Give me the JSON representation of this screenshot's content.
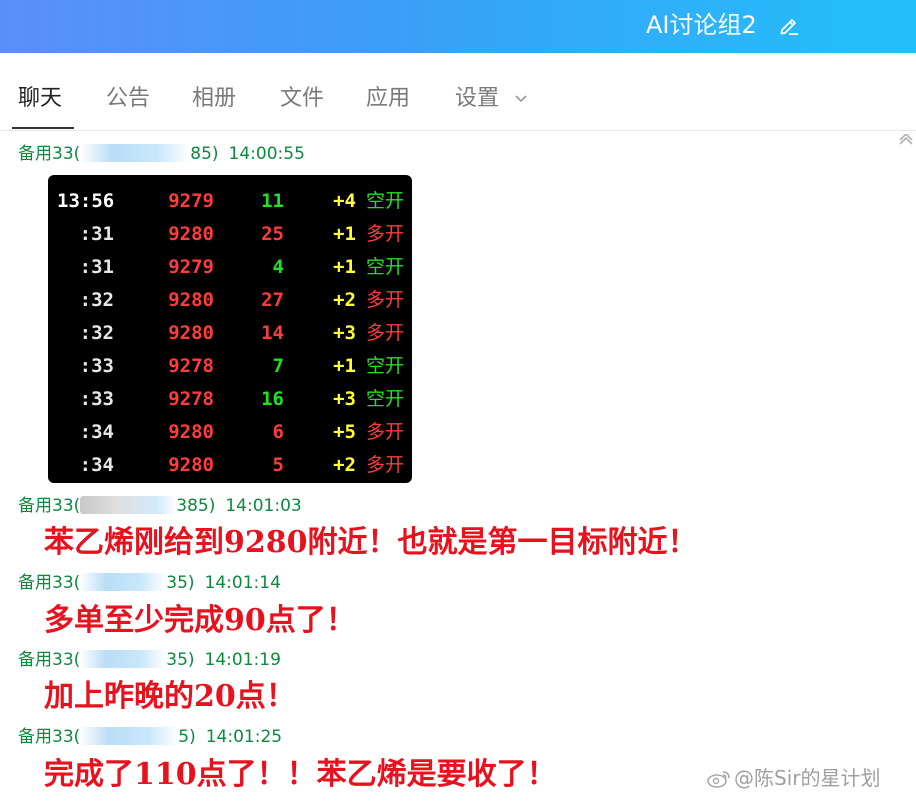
{
  "header": {
    "title": "AI讨论组2"
  },
  "tabs": [
    {
      "label": "聊天",
      "active": true
    },
    {
      "label": "公告"
    },
    {
      "label": "相册"
    },
    {
      "label": "文件"
    },
    {
      "label": "应用"
    },
    {
      "label": "设置"
    }
  ],
  "colors": {
    "header_start": "#5b8ff7",
    "header_end": "#22c0fb",
    "sender": "#0b8a3e",
    "message": "#e8121e"
  },
  "messages": [
    {
      "sender": "备用33(",
      "sender_tail": "85)",
      "time": "14:00:55"
    },
    {
      "sender": "备用33(",
      "sender_tail": "385)",
      "time": "14:01:03",
      "text": "苯乙烯刚给到9280附近！也就是第一目标附近！"
    },
    {
      "sender": "备用33(",
      "sender_tail": "35)",
      "time": "14:01:14",
      "text": "多单至少完成90点了！"
    },
    {
      "sender": "备用33(",
      "sender_tail": "35)",
      "time": "14:01:19",
      "text": "加上昨晚的20点！"
    },
    {
      "sender": "备用33(",
      "sender_tail": "5)",
      "time": "14:01:25",
      "text": "完成了110点了！！苯乙烯是要收了！"
    }
  ],
  "stock_table": {
    "rows": [
      {
        "time": "13:56",
        "price": "9279",
        "vol": "11",
        "chg": "+4",
        "type": "空开",
        "vol_color": "green",
        "type_color": "green"
      },
      {
        "time": ":31",
        "price": "9280",
        "vol": "25",
        "chg": "+1",
        "type": "多开",
        "vol_color": "red",
        "type_color": "red"
      },
      {
        "time": ":31",
        "price": "9279",
        "vol": "4",
        "chg": "+1",
        "type": "空开",
        "vol_color": "green",
        "type_color": "green"
      },
      {
        "time": ":32",
        "price": "9280",
        "vol": "27",
        "chg": "+2",
        "type": "多开",
        "vol_color": "red",
        "type_color": "red"
      },
      {
        "time": ":32",
        "price": "9280",
        "vol": "14",
        "chg": "+3",
        "type": "多开",
        "vol_color": "red",
        "type_color": "red"
      },
      {
        "time": ":33",
        "price": "9278",
        "vol": "7",
        "chg": "+1",
        "type": "空开",
        "vol_color": "green",
        "type_color": "green"
      },
      {
        "time": ":33",
        "price": "9278",
        "vol": "16",
        "chg": "+3",
        "type": "空开",
        "vol_color": "green",
        "type_color": "green"
      },
      {
        "time": ":34",
        "price": "9280",
        "vol": "6",
        "chg": "+5",
        "type": "多开",
        "vol_color": "red",
        "type_color": "red"
      },
      {
        "time": ":34",
        "price": "9280",
        "vol": "5",
        "chg": "+2",
        "type": "多开",
        "vol_color": "red",
        "type_color": "red"
      }
    ]
  },
  "watermark": "@陈Sir的星计划"
}
